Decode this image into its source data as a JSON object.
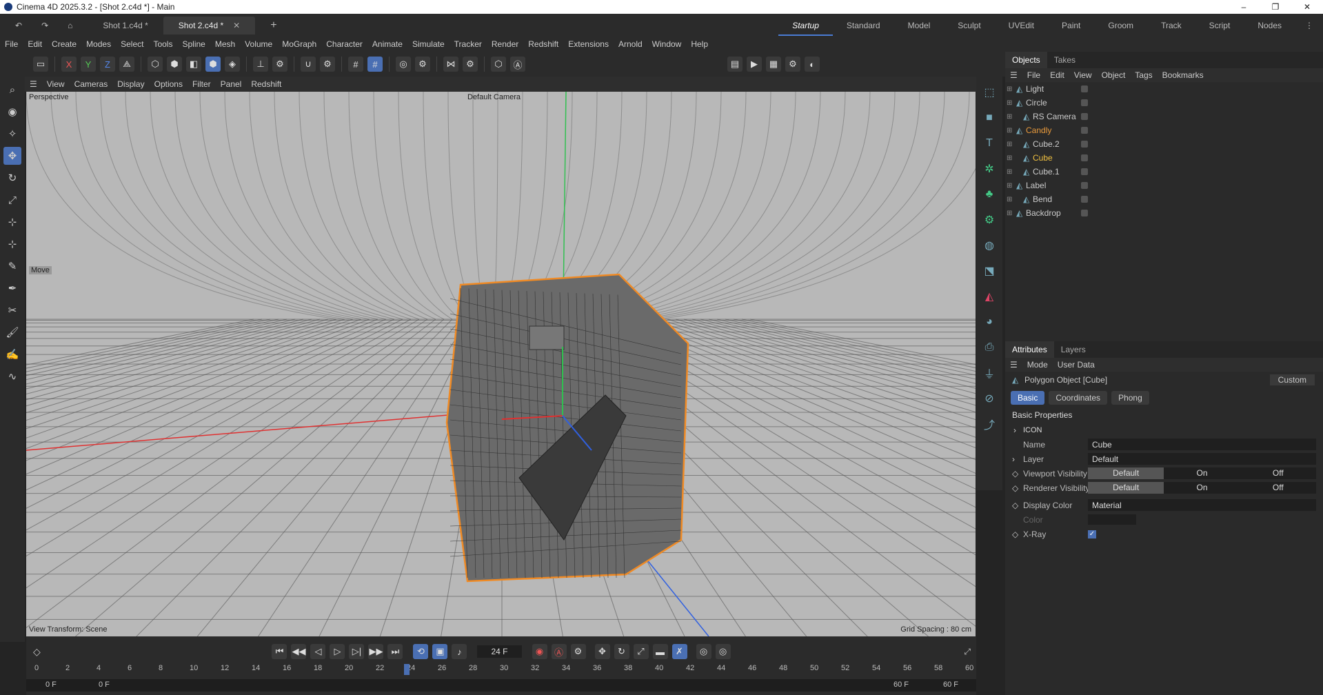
{
  "window": {
    "title": "Cinema 4D 2025.3.2 - [Shot 2.c4d *] - Main",
    "min": "–",
    "max": "❐",
    "close": "✕"
  },
  "doc_tabs": [
    {
      "label": "Shot 1.c4d *"
    },
    {
      "label": "Shot 2.c4d *",
      "close": "✕"
    }
  ],
  "add_tab": "+",
  "layouts": [
    "Startup",
    "Standard",
    "Model",
    "Sculpt",
    "UVEdit",
    "Paint",
    "Groom",
    "Track",
    "Script",
    "Nodes"
  ],
  "menu": [
    "File",
    "Edit",
    "Create",
    "Modes",
    "Select",
    "Tools",
    "Spline",
    "Mesh",
    "Volume",
    "MoGraph",
    "Character",
    "Animate",
    "Simulate",
    "Tracker",
    "Render",
    "Redshift",
    "Extensions",
    "Arnold",
    "Window",
    "Help"
  ],
  "toolbar": {
    "x": "X",
    "y": "Y",
    "z": "Z"
  },
  "viewport_menu": [
    "View",
    "Cameras",
    "Display",
    "Options",
    "Filter",
    "Panel",
    "Redshift"
  ],
  "viewport": {
    "projection": "Perspective",
    "camera": "Default Camera",
    "transform": "View Transform: Scene",
    "grid": "Grid Spacing : 80 cm",
    "move_label": "Move"
  },
  "objects_panel": {
    "tabs": [
      "Objects",
      "Takes"
    ],
    "menu": [
      "File",
      "Edit",
      "View",
      "Object",
      "Tags",
      "Bookmarks"
    ],
    "items": [
      {
        "name": "Light",
        "indent": 0,
        "color": "#cccccc"
      },
      {
        "name": "Circle",
        "indent": 0,
        "color": "#cccccc"
      },
      {
        "name": "RS Camera",
        "indent": 1,
        "color": "#cccccc"
      },
      {
        "name": "Candly",
        "indent": 0,
        "color": "#e89a3c"
      },
      {
        "name": "Cube.2",
        "indent": 1,
        "color": "#cccccc"
      },
      {
        "name": "Cube",
        "indent": 1,
        "color": "#f0c040"
      },
      {
        "name": "Cube.1",
        "indent": 1,
        "color": "#cccccc"
      },
      {
        "name": "Label",
        "indent": 0,
        "color": "#cccccc"
      },
      {
        "name": "Bend",
        "indent": 1,
        "color": "#cccccc"
      },
      {
        "name": "Backdrop",
        "indent": 0,
        "color": "#cccccc"
      }
    ]
  },
  "attributes_panel": {
    "tabs": [
      "Attributes",
      "Layers"
    ],
    "menu": [
      "Mode",
      "User Data"
    ],
    "object_type": "Polygon Object [Cube]",
    "preset": "Custom",
    "subtabs": [
      "Basic",
      "Coordinates",
      "Phong"
    ],
    "section": "Basic Properties",
    "group": "ICON",
    "fields": {
      "name_label": "Name",
      "name_value": "Cube",
      "layer_label": "Layer",
      "layer_value": "Default",
      "viewport_label": "Viewport Visibility",
      "renderer_label": "Renderer Visibility",
      "vis_options": [
        "Default",
        "On",
        "Off"
      ],
      "display_color_label": "Display Color",
      "display_color_value": "Material",
      "color_label": "Color",
      "xray_label": "X-Ray"
    }
  },
  "timeline": {
    "current_frame": "24 F",
    "start": "0 F",
    "start2": "0 F",
    "end": "60 F",
    "end2": "60 F",
    "ticks": [
      "0",
      "2",
      "4",
      "6",
      "8",
      "10",
      "12",
      "14",
      "16",
      "18",
      "20",
      "22",
      "24",
      "26",
      "28",
      "30",
      "32",
      "34",
      "36",
      "38",
      "40",
      "42",
      "44",
      "46",
      "48",
      "50",
      "52",
      "54",
      "56",
      "58",
      "60"
    ],
    "current": 24,
    "max": 60
  },
  "colors": {
    "accent": "#4a6fb3",
    "selection": "#f08a24",
    "axis_x": "#e03030",
    "axis_y": "#30c050",
    "axis_z": "#3060e0"
  }
}
